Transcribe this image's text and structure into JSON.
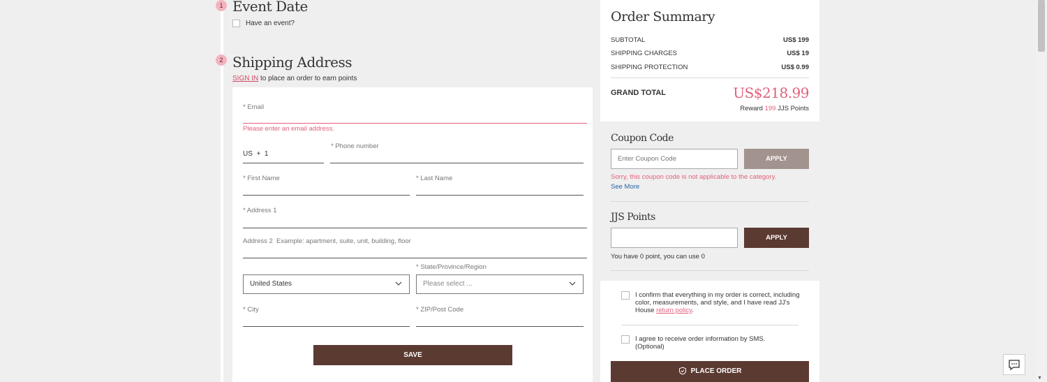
{
  "steps": {
    "event": {
      "number": "1",
      "title": "Event Date",
      "checkbox_label": "Have an event?"
    },
    "shipping": {
      "number": "2",
      "title": "Shipping Address",
      "signin_link": "SIGN IN",
      "signin_text": "to place an order to earn points"
    }
  },
  "form": {
    "email_label": "* Email",
    "email_error": "Please enter an email address.",
    "phone_prefix": "US  +  1",
    "phone_label": "* Phone number",
    "first_name_label": "* First Name",
    "last_name_label": "* Last Name",
    "address1_label": "* Address 1",
    "address2_label": "Address 2  Example: apartment, suite, unit, building, floor",
    "country_value": "United States",
    "state_label": "* State/Province/Region",
    "state_placeholder": "Please select ...",
    "city_label": "* City",
    "zip_label": "* ZIP/Post Code",
    "save_label": "SAVE"
  },
  "summary": {
    "title": "Order Summary",
    "rows": [
      {
        "label": "SUBTOTAL",
        "value": "US$ 199"
      },
      {
        "label": "SHIPPING CHARGES",
        "value": "US$ 19"
      },
      {
        "label": "SHIPPING PROTECTION",
        "value": "US$ 0.99"
      }
    ],
    "grand_total_label": "GRAND TOTAL",
    "grand_total_value": "US$218.99",
    "reward_prefix": "Reward",
    "reward_points": "199",
    "reward_suffix": "JJS Points"
  },
  "coupon": {
    "title": "Coupon Code",
    "placeholder": "Enter Coupon Code",
    "apply_label": "APPLY",
    "error": "Sorry, this coupon code is not applicable to the category.",
    "see_more": "See More"
  },
  "points": {
    "title": "JJS Points",
    "apply_label": "APPLY",
    "info": "You have 0 point, you can use 0"
  },
  "confirm": {
    "terms_text": "I confirm that everything in my order is correct, including color, measurements, and style, and I have read JJ's House",
    "return_policy_link": "return policy",
    "terms_end": ".",
    "sms_text": "I agree to receive order information by SMS. (Optional)",
    "place_order_label": "PLACE ORDER"
  },
  "colors": {
    "brand": "#5b3a32",
    "apply_disabled": "#a3938e",
    "error": "#e2607a",
    "link_blue": "#2a63a8"
  },
  "icons": {
    "select_chevron": "chevron-down-icon",
    "place_order": "shield-check-icon",
    "chat": "chat-icon"
  }
}
